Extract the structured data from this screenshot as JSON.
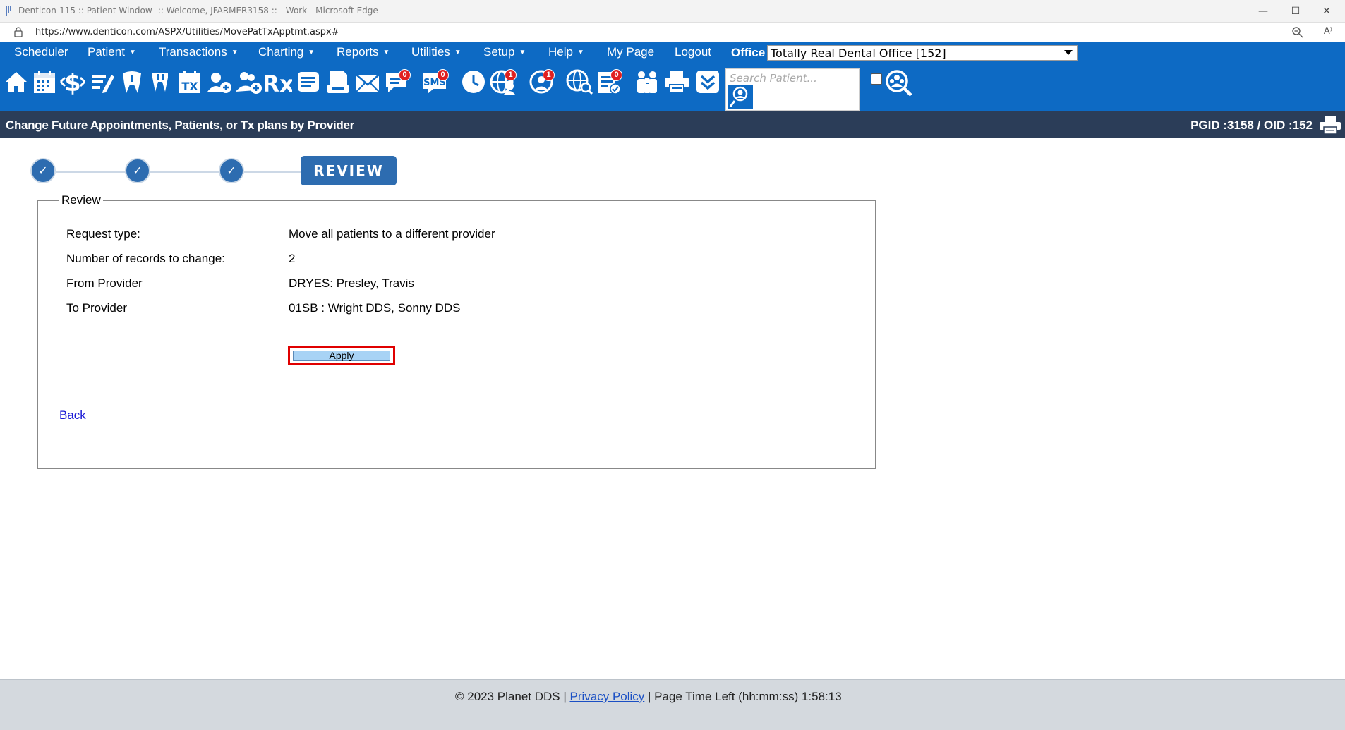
{
  "window": {
    "title": "Denticon-115 :: Patient Window -:: Welcome, JFARMER3158 :: - Work - Microsoft Edge",
    "minimize": "—",
    "maximize": "☐",
    "close": "✕"
  },
  "addressbar": {
    "url": "https://www.denticon.com/ASPX/Utilities/MovePatTxApptmt.aspx#",
    "read_aloud": "A⁾"
  },
  "menu": {
    "items": [
      {
        "label": "Scheduler"
      },
      {
        "label": "Patient"
      },
      {
        "label": "Transactions"
      },
      {
        "label": "Charting"
      },
      {
        "label": "Reports"
      },
      {
        "label": "Utilities"
      },
      {
        "label": "Setup"
      },
      {
        "label": "Help"
      },
      {
        "label": "My Page"
      },
      {
        "label": "Logout"
      }
    ],
    "office_label": "Office",
    "office_value": "Totally Real Dental Office [152]"
  },
  "toolbar": {
    "search_placeholder": "Search Patient...",
    "badges": {
      "messages": "0",
      "sms": "0",
      "online": "1",
      "alerts": "1",
      "forms": "0"
    },
    "sms_text": "SMS",
    "tx_text": "TX",
    "rx_text": "Rx"
  },
  "header": {
    "title": "Change Future Appointments, Patients, or Tx plans by Provider",
    "ids": "PGID :3158  /  OID :152"
  },
  "stepper": {
    "check": "✓",
    "current_label": "REVIEW"
  },
  "review": {
    "legend": "Review",
    "rows": [
      {
        "label": "Request type:",
        "value": "Move all patients to a different provider"
      },
      {
        "label": "Number of records to change:",
        "value": "2"
      },
      {
        "label": "From Provider",
        "value": "DRYES: Presley, Travis"
      },
      {
        "label": "To Provider",
        "value": "01SB : Wright DDS, Sonny DDS"
      }
    ],
    "apply_label": "Apply",
    "back_label": "Back"
  },
  "footer": {
    "copyright": "© 2023 Planet DDS | ",
    "privacy_label": "Privacy Policy",
    "time_left": " |  Page Time Left (hh:mm:ss) 1:58:13"
  },
  "colors": {
    "menu_blue": "#0d6ac4",
    "header_navy": "#2b3d58",
    "step_blue": "#2d6cb0",
    "apply_highlight": "#e00000",
    "footer_gray": "#d4d9de"
  }
}
